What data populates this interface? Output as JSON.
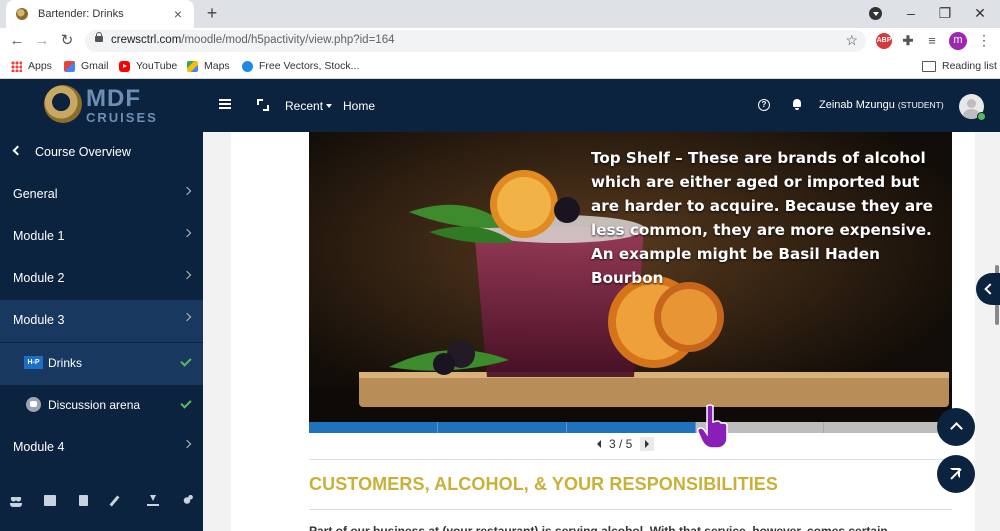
{
  "browser": {
    "tab_title": "Bartender: Drinks",
    "url_host": "crewsctrl.com",
    "url_path": "/moodle/mod/h5pactivity/view.php?id=164",
    "profile_initial": "m",
    "ext_abp_label": "ABP",
    "bookmarks": [
      "Apps",
      "Gmail",
      "YouTube",
      "Maps",
      "Free Vectors, Stock..."
    ],
    "reading_list": "Reading list"
  },
  "header": {
    "logo_text": "MDF",
    "logo_subtext": "CRUISES",
    "recent": "Recent",
    "home": "Home",
    "user_name": "Zeinab Mzungu",
    "user_role": "(STUDENT)"
  },
  "sidebar": {
    "back": "Course Overview",
    "items": [
      {
        "label": "General"
      },
      {
        "label": "Module 1"
      },
      {
        "label": "Module 2"
      },
      {
        "label": "Module 3"
      },
      {
        "label": "Drinks",
        "icon_label": "H-P"
      },
      {
        "label": "Discussion arena"
      },
      {
        "label": "Module 4"
      }
    ]
  },
  "slide": {
    "text": "Top Shelf – These are brands of alcohol which are either aged or imported but are harder to acquire.  Because they are less common, they are more expensive.  An example might be Basil Haden Bourbon",
    "current": 3,
    "total": 5,
    "pager_text": "3 / 5"
  },
  "content": {
    "heading": "CUSTOMERS, ALCOHOL, & YOUR RESPONSIBILITIES",
    "body": "Part of our business at (your restaurant) is serving alcohol.  With that service, however, comes certain"
  },
  "colors": {
    "navy": "#0c2340",
    "accent_gold": "#c9b037",
    "progress_blue": "#1e73be",
    "check_green": "#5cb85c"
  }
}
